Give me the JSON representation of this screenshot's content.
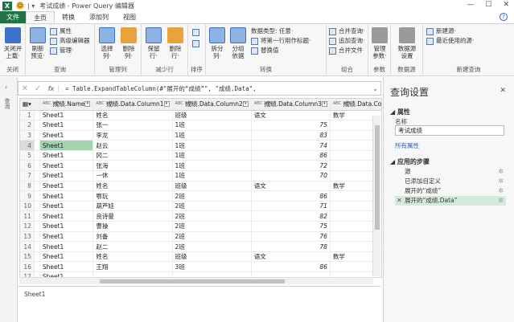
{
  "titlebar": {
    "title": "考试成绩 - Power Query 编辑器",
    "quick_access": "| ▾"
  },
  "tabs": [
    "文件",
    "主页",
    "转换",
    "添加列",
    "视图"
  ],
  "ribbon": {
    "close_apply": "关闭并\n上载·",
    "refresh": "刷新\n预览·",
    "properties": "属性",
    "advanced_editor": "高级编辑器",
    "manage": "管理·",
    "choose_columns": "选择\n列·",
    "remove_columns": "删除\n列·",
    "keep_rows": "保留\n行·",
    "remove_rows": "删除\n行·",
    "sort": "",
    "split_column": "拆分\n列·",
    "group_by": "分组\n依据",
    "data_type": "数据类型: 任意·",
    "first_row_header": "将第一行用作标题·",
    "replace_values": "替换值",
    "merge_queries": "合并查询·",
    "append_queries": "追加查询·",
    "combine_files": "合并文件",
    "manage_params": "管理\n参数·",
    "data_source_settings": "数据源\n设置",
    "new_source": "新建源·",
    "recent_sources": "最近使用的源·",
    "groups": [
      "关闭",
      "查询",
      "管理列",
      "减少行",
      "排序",
      "转换",
      "组合",
      "参数",
      "数据源",
      "新建查询"
    ]
  },
  "formula": {
    "text": "= Table.ExpandTableColumn(#\"展开的“成绩”\", \"成绩.Data\","
  },
  "leftrail_label": "查询",
  "grid": {
    "headers": [
      "成绩.Name",
      "成绩.Data.Column1",
      "成绩.Data.Column2",
      "成绩.Data.Column3",
      "成绩.Data.Column"
    ],
    "type_label": "ABC 123",
    "rows": [
      [
        "1",
        "Sheet1",
        "姓名",
        "班级",
        "语文",
        "数学"
      ],
      [
        "2",
        "Sheet1",
        "张一",
        "1班",
        "75",
        ""
      ],
      [
        "3",
        "Sheet1",
        "李龙",
        "1班",
        "83",
        ""
      ],
      [
        "4",
        "Sheet1",
        "赵云",
        "1班",
        "74",
        ""
      ],
      [
        "5",
        "Sheet1",
        "冈二",
        "1班",
        "86",
        ""
      ],
      [
        "6",
        "Sheet1",
        "张海",
        "1班",
        "72",
        ""
      ],
      [
        "7",
        "Sheet1",
        "一休",
        "1班",
        "70",
        ""
      ],
      [
        "8",
        "Sheet1",
        "姓名",
        "班级",
        "语文",
        "数学"
      ],
      [
        "9",
        "Sheet1",
        "鄂玩",
        "2班",
        "86",
        ""
      ],
      [
        "10",
        "Sheet1",
        "葫芦娃",
        "2班",
        "71",
        ""
      ],
      [
        "11",
        "Sheet1",
        "良诗曼",
        "2班",
        "82",
        ""
      ],
      [
        "12",
        "Sheet1",
        "曹操",
        "2班",
        "75",
        ""
      ],
      [
        "13",
        "Sheet1",
        "刘备",
        "2班",
        "76",
        ""
      ],
      [
        "14",
        "Sheet1",
        "赵二",
        "2班",
        "78",
        ""
      ],
      [
        "15",
        "Sheet1",
        "姓名",
        "班级",
        "语文",
        "数学"
      ],
      [
        "16",
        "Sheet1",
        "王翔",
        "3班",
        "86",
        ""
      ],
      [
        "17",
        "Sheet1",
        "",
        "",
        "",
        ""
      ]
    ]
  },
  "preview_text": "Sheet1",
  "query_settings": {
    "title": "查询设置",
    "properties": "属性",
    "name_label": "名称",
    "name_value": "考试成绩",
    "all_properties": "所有属性",
    "applied_steps": "应用的步骤",
    "steps": [
      "源",
      "已添加自定义",
      "展开的“成绩”",
      "展开的“成绩.Data”"
    ]
  }
}
